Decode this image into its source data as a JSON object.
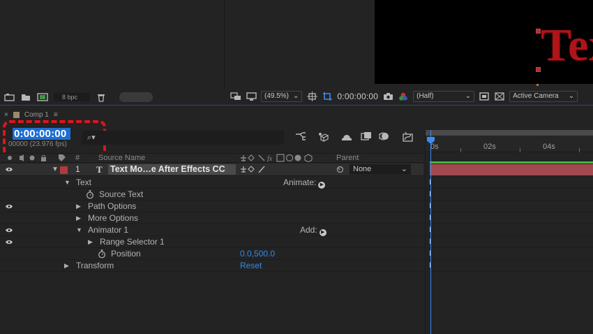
{
  "project_panel": {
    "bpc_label": "8 bpc"
  },
  "viewer": {
    "comp_text": "Tex",
    "zoom": "(49.5%)",
    "timecode": "0:00:00:00",
    "resolution": "(Half)",
    "camera": "Active Camera"
  },
  "timeline": {
    "tab_label": "Comp 1",
    "timecode": "0:00:00:00",
    "frames_fps": "00000 (23.976 fps)",
    "search_placeholder": "⌕▾",
    "columns": {
      "hash": "#",
      "source_name": "Source Name",
      "parent": "Parent"
    },
    "layer": {
      "number": "1",
      "type_glyph": "T",
      "name": "Text Mo…e After Effects CC",
      "parent": "None"
    },
    "properties": [
      {
        "label": "Text",
        "right_label": "Animate:",
        "value": ""
      },
      {
        "label": "Source Text",
        "right_label": "",
        "value": ""
      },
      {
        "label": "Path Options",
        "right_label": "",
        "value": ""
      },
      {
        "label": "More Options",
        "right_label": "",
        "value": ""
      },
      {
        "label": "Animator 1",
        "right_label": "Add:",
        "value": ""
      },
      {
        "label": "Range Selector 1",
        "right_label": "",
        "value": ""
      },
      {
        "label": "Position",
        "right_label": "",
        "value": "0.0,500.0"
      },
      {
        "label": "Transform",
        "right_label": "",
        "value": "Reset"
      }
    ],
    "ruler": [
      "0s",
      "02s",
      "04s"
    ]
  },
  "colors": {
    "timecode_bg": "#1e6fd0",
    "highlight_dash": "#e0141c",
    "link_blue": "#2d8ceb",
    "layer_bar": "#a34a50",
    "playhead": "#3a8ef0"
  }
}
